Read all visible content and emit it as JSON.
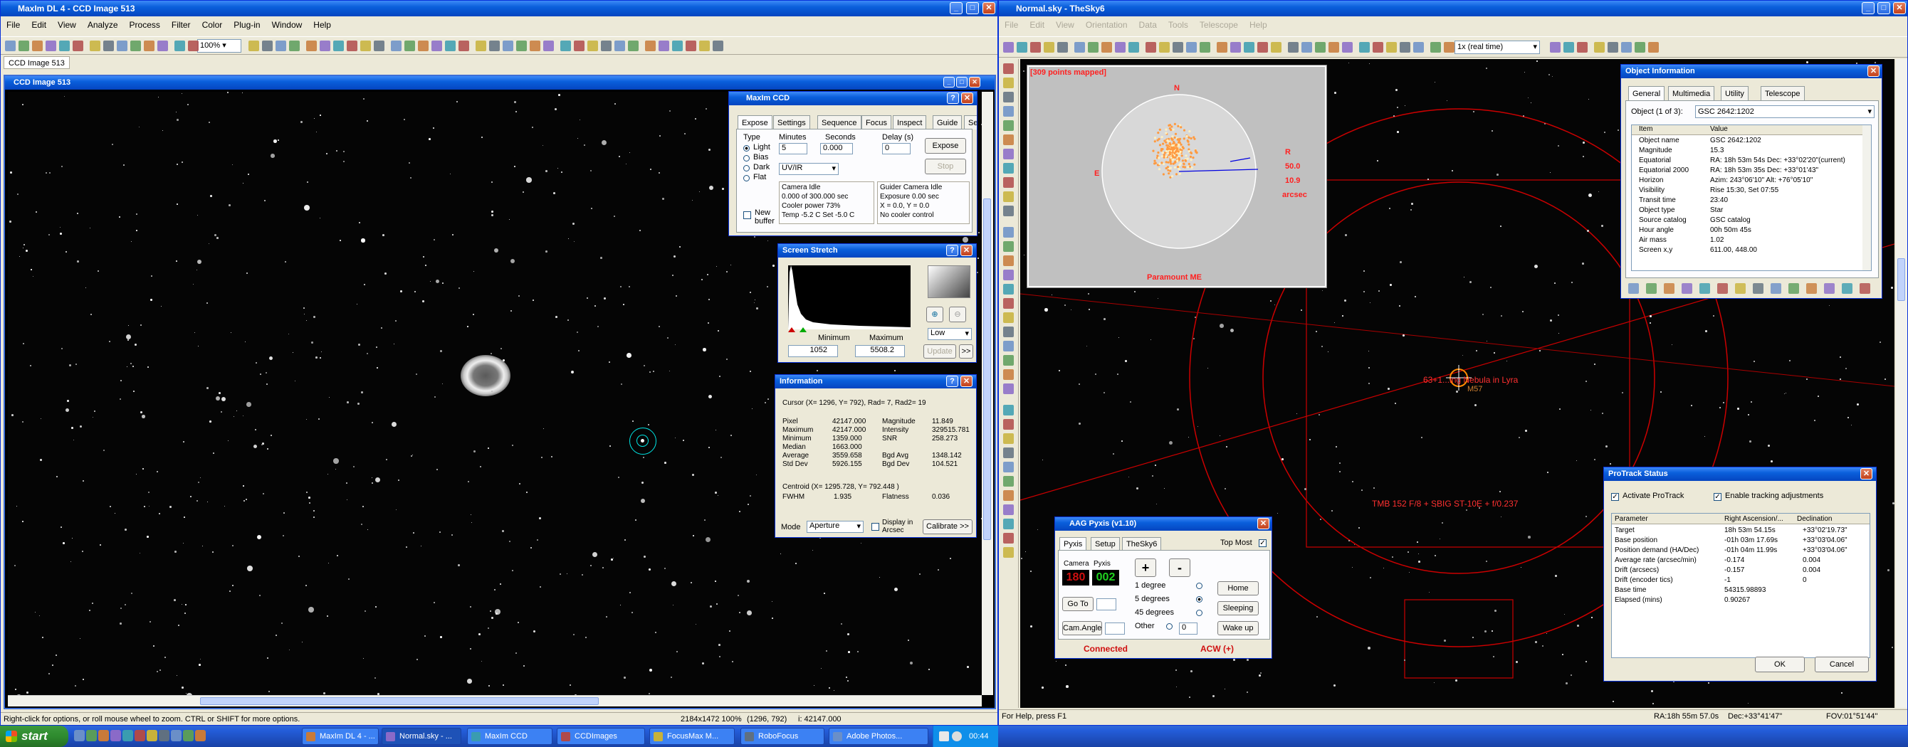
{
  "maxim": {
    "title": "MaxIm DL 4 - CCD Image 513",
    "menu": [
      "File",
      "Edit",
      "View",
      "Analyze",
      "Process",
      "Filter",
      "Color",
      "Plug-in",
      "Window",
      "Help"
    ],
    "zoom": "100%",
    "doc_tab": "CCD Image 513",
    "image_title": "CCD Image 513",
    "status_left": "Right-click for options, or roll mouse wheel to zoom. CTRL or SHIFT for more options.",
    "status_size": "2184x1472  100%",
    "status_pos": "(1296, 792)",
    "status_val": "i: 42147.000"
  },
  "ccd": {
    "title": "MaxIm CCD",
    "tabs": [
      "Expose",
      "Settings",
      "Sequence",
      "Focus",
      "Inspect",
      "Guide",
      "Setup"
    ],
    "type_label": "Type",
    "types": [
      "Light",
      "Bias",
      "Dark",
      "Flat"
    ],
    "minutes_label": "Minutes",
    "minutes": "5",
    "seconds_label": "Seconds",
    "seconds": "0.000",
    "delay_label": "Delay (s)",
    "delay": "0",
    "filter": "UV/IR",
    "expose": "Expose",
    "stop": "Stop",
    "cam_status": [
      "Camera Idle",
      "0.000 of 300.000 sec",
      "Cooler power 73%",
      "Temp -5.2 C Set -5.0 C"
    ],
    "guider_status": [
      "Guider Camera Idle",
      "Exposure 0.00 sec",
      "X = 0.0, Y = 0.0",
      "No cooler control"
    ],
    "new_buffer": "New buffer"
  },
  "stretch": {
    "title": "Screen Stretch",
    "min_label": "Minimum",
    "max_label": "Maximum",
    "min": "1052",
    "max": "5508.2",
    "mode": "Low",
    "update": "Update"
  },
  "info": {
    "title": "Information",
    "cursor": "Cursor      (X= 1296, Y= 792), Rad= 7, Rad2= 19",
    "left": [
      [
        "Pixel",
        "42147.000"
      ],
      [
        "Maximum",
        "42147.000"
      ],
      [
        "Minimum",
        "1359.000"
      ],
      [
        "Median",
        "1663.000"
      ],
      [
        "Average",
        "3559.658"
      ],
      [
        "Std Dev",
        "5926.155"
      ]
    ],
    "right": [
      [
        "Magnitude",
        "11.849"
      ],
      [
        "Intensity",
        "329515.781"
      ],
      [
        "SNR",
        "258.273"
      ],
      [
        "",
        ""
      ],
      [
        "Bgd Avg",
        "1348.142"
      ],
      [
        "Bgd Dev",
        "104.521"
      ]
    ],
    "centroid": "Centroid        (X= 1295.728, Y= 792.448 )",
    "fwhm_label": "FWHM",
    "fwhm": "1.935",
    "flat_label": "Flatness",
    "flat": "0.036",
    "mode_label": "Mode",
    "mode": "Aperture",
    "display_arcsec": "Display in Arcsec",
    "calibrate": "Calibrate >>"
  },
  "sky6": {
    "title": "Normal.sky - TheSky6",
    "menu": [
      "File",
      "Edit",
      "View",
      "Orientation",
      "Data",
      "Tools",
      "Telescope",
      "Help"
    ],
    "time_rate": "1x (real time)",
    "status_left": "For Help, press F1",
    "status_ra": "RA:18h 55m 57.0s",
    "status_dec": "Dec:+33°41'47\"",
    "status_fov": "FOV:01°51'44\"",
    "object_label": "63+1...ing Nebula in Lyra",
    "object_sub": "M57",
    "fov_label": "TMB 152 F/8 + SBIG ST-10E + f/0.237"
  },
  "tpoint": {
    "header": "[309 points mapped]",
    "north": "N",
    "east": "E",
    "r_label": "R",
    "r1": "50.0",
    "r2": "10.9",
    "unit": "arcsec",
    "mount": "Paramount ME"
  },
  "objinfo": {
    "title": "Object Information",
    "tabs": [
      "General",
      "Multimedia",
      "Utility",
      "Telescope"
    ],
    "object_label": "Object (1 of 3):",
    "object": "GSC 2642:1202",
    "col_item": "Item",
    "col_value": "Value",
    "rows": [
      [
        "Object name",
        "GSC 2642:1202"
      ],
      [
        "Magnitude",
        "15.3"
      ],
      [
        "Equatorial",
        "RA: 18h 53m 54s   Dec: +33°02'20\"(current)"
      ],
      [
        "Equatorial 2000",
        "RA: 18h 53m 35s   Dec: +33°01'43\""
      ],
      [
        "Horizon",
        "Azim: 243°06'10\"   Alt: +76°05'10\""
      ],
      [
        "Visibility",
        "Rise 15:30,   Set 07:55"
      ],
      [
        "Transit time",
        "23:40"
      ],
      [
        "Object type",
        "Star"
      ],
      [
        "Source catalog",
        "GSC catalog"
      ],
      [
        "Hour angle",
        "00h 50m 45s"
      ],
      [
        "Air mass",
        "1.02"
      ],
      [
        "Screen x,y",
        "611.00, 448.00"
      ]
    ]
  },
  "protrack": {
    "title": "ProTrack Status",
    "activate": "Activate ProTrack",
    "enable": "Enable tracking adjustments",
    "cols": [
      "Parameter",
      "Right Ascension/...",
      "Declination"
    ],
    "rows": [
      [
        "Target",
        "18h 53m 54.15s",
        "+33°02'19.73\""
      ],
      [
        "Base position",
        "-01h 03m 17.69s",
        "+33°03'04.06\""
      ],
      [
        "Position demand (HA/Dec)",
        "-01h 04m 11.99s",
        "+33°03'04.06\""
      ],
      [
        "Average rate (arcsec/min)",
        "-0.174",
        "0.004"
      ],
      [
        "Drift (arcsecs)",
        "-0.157",
        "0.004"
      ],
      [
        "Drift (encoder tics)",
        "-1",
        "0"
      ],
      [
        "Base time",
        "54315.98893",
        ""
      ],
      [
        "Elapsed (mins)",
        "0.90267",
        ""
      ]
    ],
    "ok": "OK",
    "cancel": "Cancel"
  },
  "aag": {
    "title": "AAG Pyxis (v1.10)",
    "tabs": [
      "Pyxis",
      "Setup",
      "TheSky6"
    ],
    "top_most": "Top Most",
    "camera_label": "Camera",
    "pyxis_label": "Pyxis",
    "camera_val": "180",
    "pyxis_val": "002",
    "plus": "+",
    "minus": "-",
    "goto": "Go To",
    "cam_angle": "Cam.Angle",
    "steps": [
      "1 degree",
      "5 degrees",
      "45 degrees",
      "Other"
    ],
    "other_val": "0",
    "home": "Home",
    "sleeping": "Sleeping",
    "wake": "Wake up",
    "connected": "Connected",
    "direction": "ACW (+)"
  },
  "taskbar": {
    "start": "start",
    "tasks": [
      "MaxIm DL 4 - ...",
      "Normal.sky - ...",
      "MaxIm CCD",
      "CCDImages",
      "FocusMax  M...",
      "RoboFocus",
      "Adobe Photos..."
    ],
    "clock": "00:44"
  },
  "colors": {
    "title_blue": "#0a5fdb",
    "accent_red": "#ff2020",
    "teal": "#00e5e5"
  }
}
